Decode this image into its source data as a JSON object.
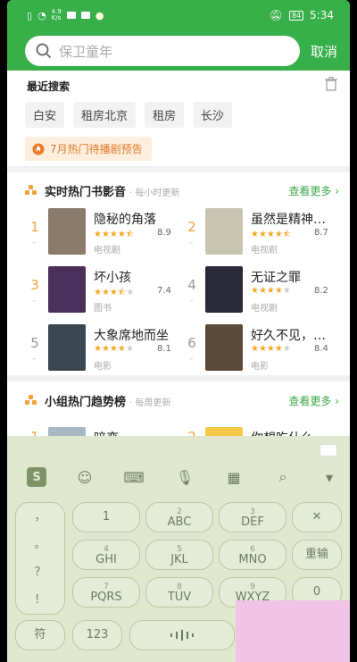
{
  "status": {
    "net_speed_top": "4.9",
    "net_speed_bottom": "K/s",
    "battery": "84",
    "time": "5:34"
  },
  "search": {
    "placeholder": "保卫童年",
    "cancel": "取消"
  },
  "recent": {
    "title": "最近搜索",
    "tags": [
      "白安",
      "租房北京",
      "租房",
      "长沙"
    ],
    "promo": "7月热门待播剧预告"
  },
  "realtime": {
    "title": "实时热门书影音",
    "subtitle": "· 每小时更新",
    "more": "查看更多",
    "items": [
      {
        "rank": "1",
        "name": "隐秘的角落",
        "rating": 4.5,
        "score": "8.9",
        "cat": "电视剧"
      },
      {
        "rank": "2",
        "name": "虽然是精神…",
        "rating": 4.5,
        "score": "8.7",
        "cat": "电视剧"
      },
      {
        "rank": "3",
        "name": "坏小孩",
        "rating": 3.5,
        "score": "7.4",
        "cat": "图书"
      },
      {
        "rank": "4",
        "name": "无证之罪",
        "rating": 4,
        "score": "8.2",
        "cat": "电视剧"
      },
      {
        "rank": "5",
        "name": "大象席地而坐",
        "rating": 4,
        "score": "8.1",
        "cat": "电影"
      },
      {
        "rank": "6",
        "name": "好久不见，…",
        "rating": 4,
        "score": "8.4",
        "cat": "电影"
      }
    ]
  },
  "group": {
    "title": "小组热门趋势榜",
    "subtitle": "· 每周更新",
    "more": "查看更多",
    "items": [
      {
        "rank": "1",
        "name": "暗恋"
      },
      {
        "rank": "2",
        "name": "你想吃什么"
      }
    ]
  },
  "keyboard": {
    "side": [
      "，",
      "。",
      "？",
      "！"
    ],
    "rows": [
      [
        {
          "n": "1",
          "l": ""
        },
        {
          "n": "2",
          "l": "ABC"
        },
        {
          "n": "3",
          "l": "DEF"
        }
      ],
      [
        {
          "n": "4",
          "l": "GHI"
        },
        {
          "n": "5",
          "l": "JKL"
        },
        {
          "n": "6",
          "l": "MNO"
        }
      ],
      [
        {
          "n": "7",
          "l": "PQRS"
        },
        {
          "n": "8",
          "l": "TUV"
        },
        {
          "n": "9",
          "l": "WXYZ"
        }
      ]
    ],
    "row1_right": "1",
    "delete": "✕",
    "reenter": "重输",
    "zero": "0",
    "symbols": "符",
    "num": "123"
  },
  "colors": {
    "brand": "#37b04a",
    "hot": "#f2a23b",
    "star": "#f5a623"
  }
}
